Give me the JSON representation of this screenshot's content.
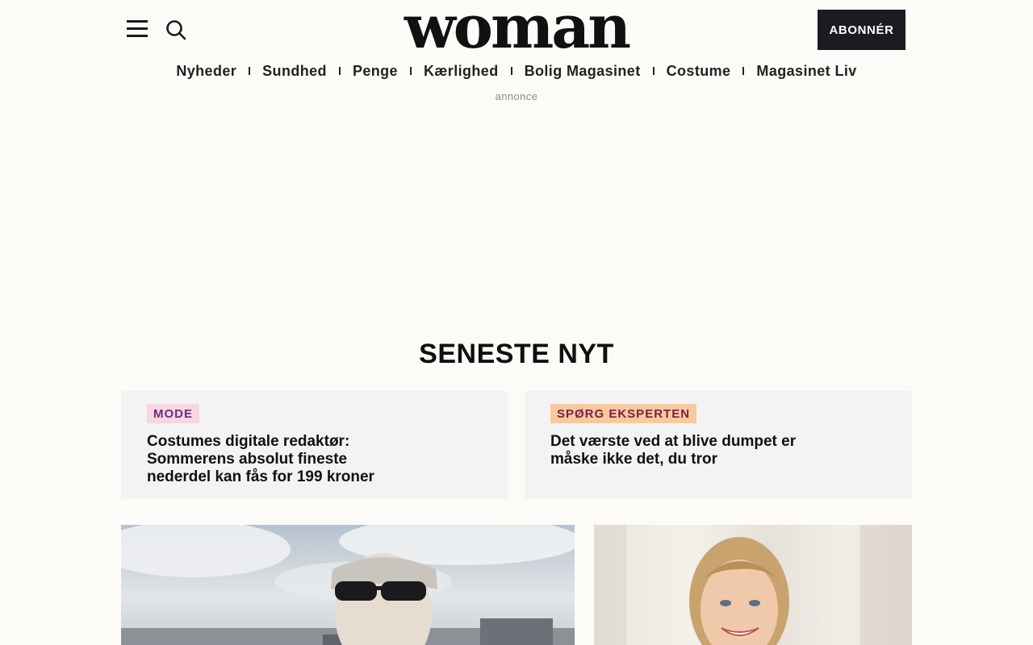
{
  "header": {
    "logo": "woman",
    "subscribe_label": "ABONNÉR",
    "menu_icon": "hamburger-menu-icon",
    "search_icon": "search-icon"
  },
  "nav": {
    "items": [
      "Nyheder",
      "Sundhed",
      "Penge",
      "Kærlighed",
      "Bolig Magasinet",
      "Costume",
      "Magasinet Liv"
    ]
  },
  "ad_label": "annonce",
  "section": {
    "title": "SENESTE NYT",
    "cards": [
      {
        "tag": "MODE",
        "title": "Costumes digitale redaktør: Sommerens absolut fineste nederdel kan fås for 199 kroner"
      },
      {
        "tag": "SPØRG EKSPERTEN",
        "title": "Det værste ved at blive dumpet er måske ikke det, du tror"
      }
    ]
  },
  "colors": {
    "background": "#fcfbf7",
    "subscribe_bg": "#1b1b22",
    "tag_mode_bg": "#f8d6dd",
    "tag_mode_text": "#6a2c86",
    "tag_expert_bg": "#f9c99c",
    "tag_expert_text": "#7a1f4a",
    "card_bg": "#f3f3f3"
  }
}
